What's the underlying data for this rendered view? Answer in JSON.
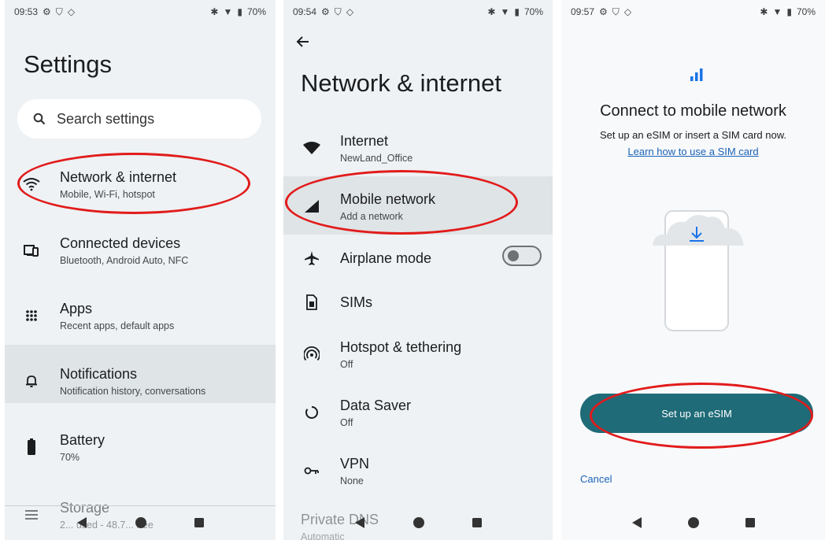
{
  "screen1": {
    "status": {
      "time": "09:53",
      "battery": "70%"
    },
    "title": "Settings",
    "search_placeholder": "Search settings",
    "items": [
      {
        "title": "Network & internet",
        "subtitle": "Mobile, Wi-Fi, hotspot",
        "icon": "wifi-icon"
      },
      {
        "title": "Connected devices",
        "subtitle": "Bluetooth, Android Auto, NFC",
        "icon": "devices-icon"
      },
      {
        "title": "Apps",
        "subtitle": "Recent apps, default apps",
        "icon": "apps-grid-icon"
      },
      {
        "title": "Notifications",
        "subtitle": "Notification history, conversations",
        "icon": "bell-icon"
      },
      {
        "title": "Battery",
        "subtitle": "70%",
        "icon": "battery-icon"
      },
      {
        "title": "Storage",
        "subtitle": "2... used - 48.7... free",
        "icon": "storage-icon"
      }
    ]
  },
  "screen2": {
    "status": {
      "time": "09:54",
      "battery": "70%"
    },
    "title": "Network & internet",
    "items": [
      {
        "title": "Internet",
        "subtitle": "NewLand_Office",
        "icon": "wifi-filled-icon"
      },
      {
        "title": "Mobile network",
        "subtitle": "Add a network",
        "icon": "signal-icon"
      },
      {
        "title": "Airplane mode",
        "subtitle": "",
        "icon": "airplane-icon"
      },
      {
        "title": "SIMs",
        "subtitle": "",
        "icon": "sim-icon"
      },
      {
        "title": "Hotspot & tethering",
        "subtitle": "Off",
        "icon": "hotspot-icon"
      },
      {
        "title": "Data Saver",
        "subtitle": "Off",
        "icon": "data-saver-icon"
      },
      {
        "title": "VPN",
        "subtitle": "None",
        "icon": "vpn-key-icon"
      },
      {
        "title": "Private DNS",
        "subtitle": "Automatic",
        "icon": ""
      }
    ],
    "airplane_mode_on": false
  },
  "screen3": {
    "status": {
      "time": "09:57",
      "battery": "70%"
    },
    "title": "Connect to mobile network",
    "subtitle": "Set up an eSIM or insert a SIM card now.",
    "link": "Learn how to use a SIM card",
    "primary_button": "Set up an eSIM",
    "cancel": "Cancel"
  },
  "colors": {
    "highlight": "#dfe4e6",
    "button": "#1f6b78",
    "link": "#1a63b8",
    "annotation": "#e21b1b"
  }
}
